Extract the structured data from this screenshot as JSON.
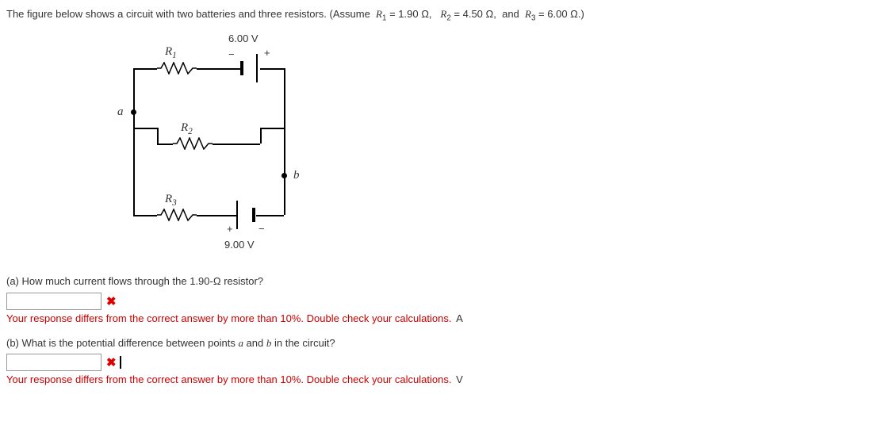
{
  "prompt": {
    "lead": "The figure below shows a circuit with two batteries and three resistors. (Assume",
    "r1_lhs": "R",
    "r1_sub": "1",
    "eq": " = ",
    "r1_val": "1.90 Ω,",
    "r2_lhs": "R",
    "r2_sub": "2",
    "r2_val": "4.50 Ω,",
    "and": "and",
    "r3_lhs": "R",
    "r3_sub": "3",
    "r3_val": "6.00 Ω.)"
  },
  "circuit": {
    "top_voltage": "6.00 V",
    "bottom_voltage": "9.00 V",
    "r1_label": "R",
    "r1_sub": "1",
    "r2_label": "R",
    "r2_sub": "2",
    "r3_label": "R",
    "r3_sub": "3",
    "node_a": "a",
    "node_b": "b",
    "plus": "+",
    "minus": "−"
  },
  "part_a": {
    "question_lead": "(a) How much current flows through the ",
    "ohm_value": "1.90-Ω",
    "question_tail": " resistor?",
    "feedback": "Your response differs from the correct answer by more than 10%. Double check your calculations.",
    "unit": "A"
  },
  "part_b": {
    "question_lead": "(b) What is the potential difference between points ",
    "pt_a": "a",
    "mid": " and ",
    "pt_b": "b",
    "question_tail": " in the circuit?",
    "feedback": "Your response differs from the correct answer by more than 10%. Double check your calculations.",
    "unit": "V"
  }
}
